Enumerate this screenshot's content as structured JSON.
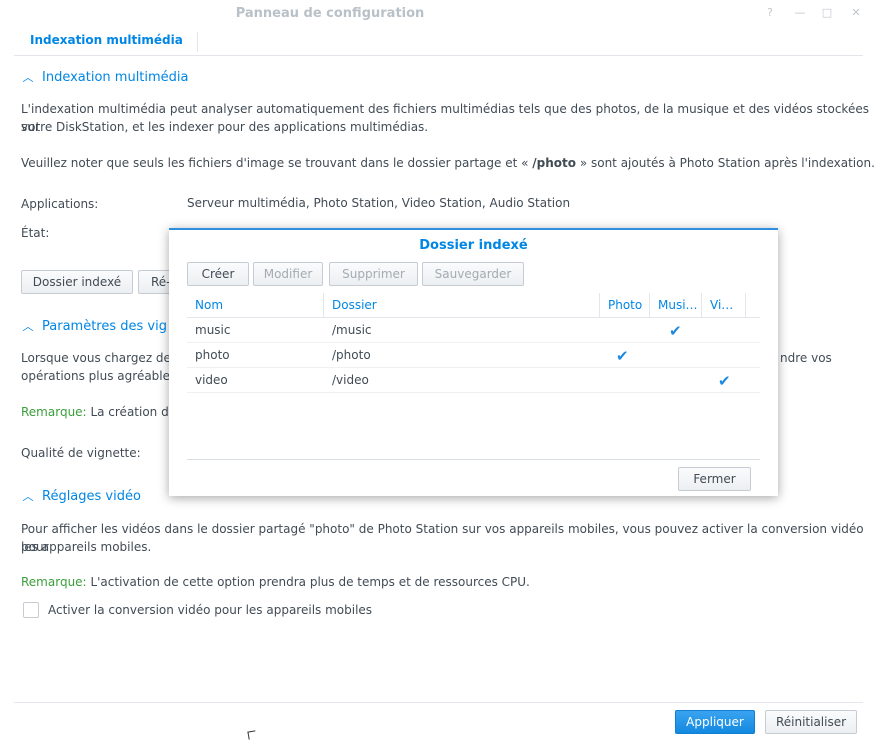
{
  "window": {
    "title": "Panneau de configuration",
    "controls": [
      "?",
      "—",
      "□",
      "✕"
    ]
  },
  "tabs": [
    {
      "label": "Indexation multimédia",
      "active": true
    }
  ],
  "section1": {
    "title": "Indexation multimédia",
    "desc_line1": "L'indexation multimédia peut analyser automatiquement des fichiers multimédias tels que des photos, de la musique et des vidéos stockées sur",
    "desc_line2": "votre DiskStation, et les indexer pour des applications multimédias.",
    "note_prefix": "Veuillez noter que seuls les fichiers d'image se trouvant dans le dossier partage et « ",
    "note_bold": "/photo",
    "note_suffix": " » sont ajoutés à Photo Station après l'indexation.",
    "applications_label": "Applications:",
    "applications_value": "Serveur multimédia, Photo Station, Video Station, Audio Station",
    "state_label": "État:",
    "btn_indexed_folder": "Dossier indexé",
    "btn_reindex_partial": "Ré-"
  },
  "section2": {
    "title_partial": "Paramètres des vig",
    "desc_line1_partial": "Lorsque vous chargez des",
    "desc_line1_right": "ndre vos",
    "desc_line2_partial": "opérations plus agréables",
    "remark_label": "Remarque:",
    "remark_partial": "La création de",
    "quality_label": "Qualité de vignette:"
  },
  "section3": {
    "title": "Réglages vidéo",
    "desc_line1": "Pour afficher les vidéos dans le dossier partagé \"photo\" de Photo Station sur vos appareils mobiles, vous pouvez activer la conversion vidéo pour",
    "desc_line2": "les appareils mobiles.",
    "remark_label": "Remarque:",
    "remark_text": "L'activation de cette option prendra plus de temps et de ressources CPU.",
    "checkbox_label": "Activer la conversion vidéo pour les appareils mobiles",
    "checkbox_checked": false
  },
  "footer": {
    "apply": "Appliquer",
    "reset": "Réinitialiser"
  },
  "dialog": {
    "title": "Dossier indexé",
    "toolbar": {
      "create": "Créer",
      "modify": "Modifier",
      "delete": "Supprimer",
      "save": "Sauvegarder"
    },
    "columns": {
      "name": "Nom",
      "folder": "Dossier",
      "photo": "Photo",
      "music": "Musi…",
      "video": "Vi…"
    },
    "rows": [
      {
        "name": "music",
        "folder": "/music",
        "photo": false,
        "music": true,
        "video": false
      },
      {
        "name": "photo",
        "folder": "/photo",
        "photo": true,
        "music": false,
        "video": false
      },
      {
        "name": "video",
        "folder": "/video",
        "photo": false,
        "music": false,
        "video": true
      }
    ],
    "check_glyph": "✔",
    "close": "Fermer"
  },
  "colors": {
    "accent": "#0086e5",
    "remark_green": "#3a9e3a",
    "check_blue": "#1d8ae0"
  }
}
